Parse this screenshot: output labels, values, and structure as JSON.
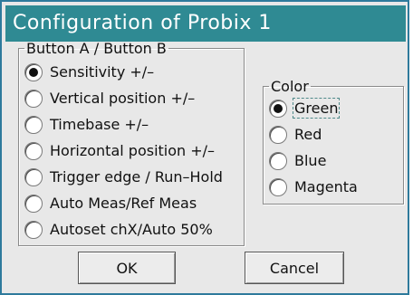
{
  "window": {
    "title": "Configuration of Probix 1"
  },
  "button_group": {
    "legend": "Button A / Button B",
    "options": [
      {
        "label": "Sensitivity +/–",
        "selected": true
      },
      {
        "label": "Vertical position +/–",
        "selected": false
      },
      {
        "label": "Timebase +/–",
        "selected": false
      },
      {
        "label": "Horizontal position +/–",
        "selected": false
      },
      {
        "label": "Trigger edge / Run–Hold",
        "selected": false
      },
      {
        "label": "Auto Meas/Ref Meas",
        "selected": false
      },
      {
        "label": "Autoset chX/Auto 50%",
        "selected": false
      }
    ]
  },
  "color_group": {
    "legend": "Color",
    "options": [
      {
        "label": "Green",
        "selected": true
      },
      {
        "label": "Red",
        "selected": false
      },
      {
        "label": "Blue",
        "selected": false
      },
      {
        "label": "Magenta",
        "selected": false
      }
    ]
  },
  "buttons": {
    "ok_label": "OK",
    "cancel_label": "Cancel"
  },
  "colors": {
    "title_bar": "#2f8a93",
    "title_text": "#ffffff",
    "dialog_background": "#e8e8e8",
    "window_border": "#2e7a9c"
  }
}
